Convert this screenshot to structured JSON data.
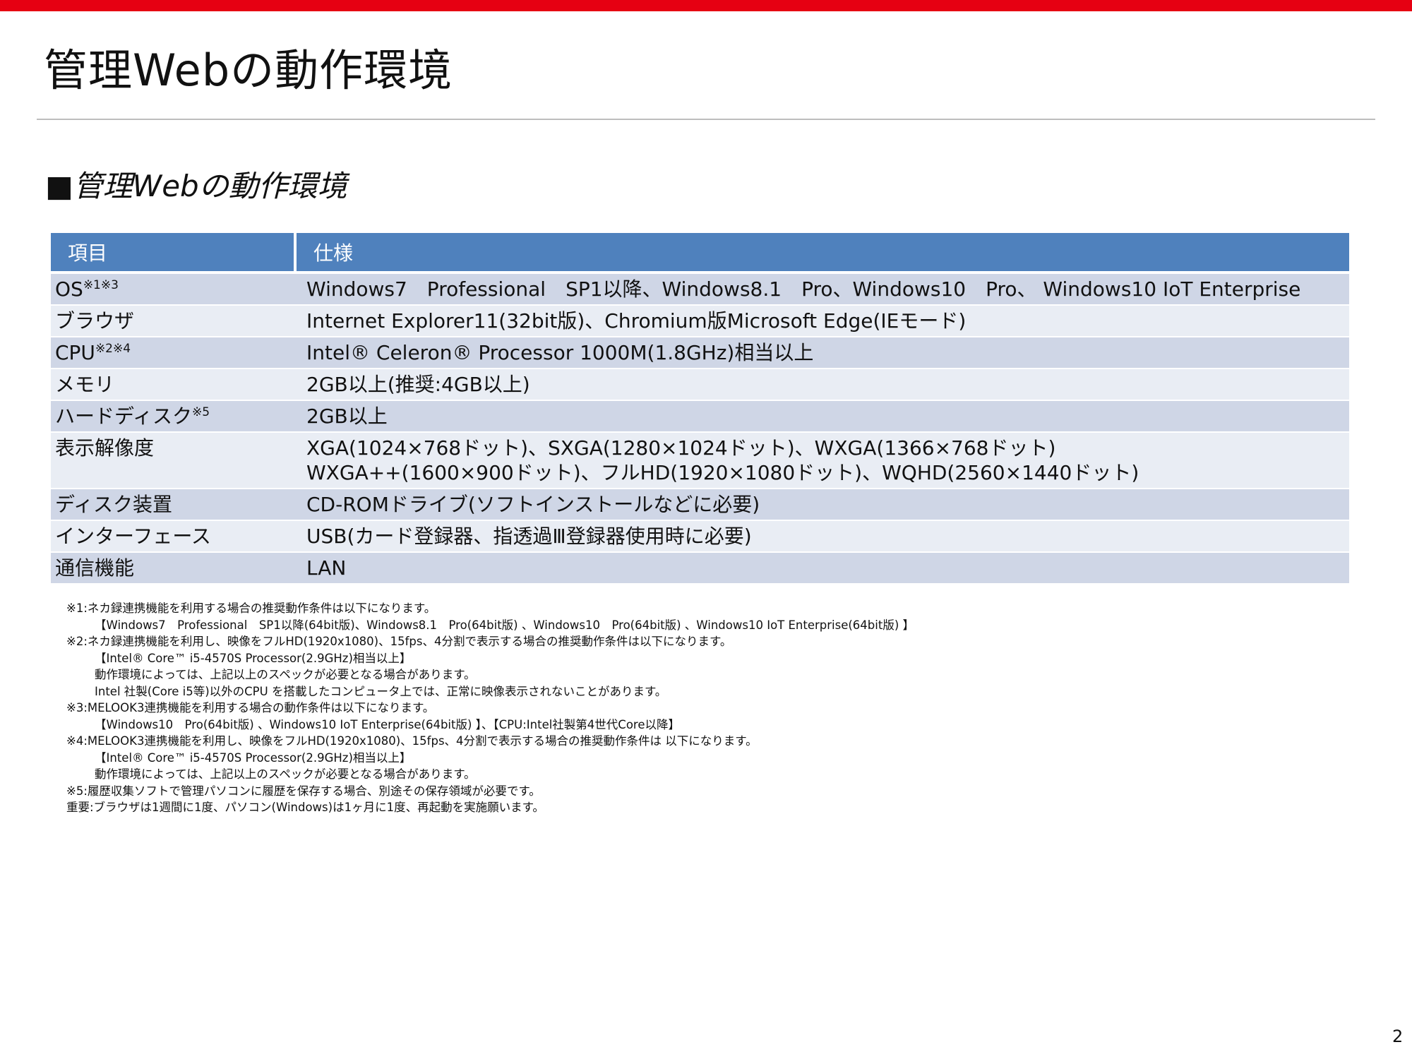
{
  "page": {
    "title": "管理Webの動作環境",
    "section_heading": "■管理Webの動作環境",
    "page_number": "2",
    "accent_color": "#e60012",
    "header_color": "#4f81bd"
  },
  "table": {
    "headers": [
      "項目",
      "仕様"
    ],
    "rows": [
      {
        "item": "OS",
        "sup": "※1※3",
        "spec": "Windows7　Professional　SP1以降、Windows8.1　Pro、Windows10　Pro、 Windows10 IoT Enterprise",
        "spec2": ""
      },
      {
        "item": "ブラウザ",
        "sup": "",
        "spec": "Internet Explorer11(32bit版)、Chromium版Microsoft Edge(IEモード)",
        "spec2": ""
      },
      {
        "item": "CPU",
        "sup": "※2※4",
        "spec": "Intel® Celeron® Processor 1000M(1.8GHz)相当以上",
        "spec2": ""
      },
      {
        "item": "メモリ",
        "sup": "",
        "spec": "2GB以上(推奨:4GB以上)",
        "spec2": ""
      },
      {
        "item": "ハードディスク",
        "sup": "※5",
        "spec": "2GB以上",
        "spec2": ""
      },
      {
        "item": "表示解像度",
        "sup": "",
        "spec": "XGA(1024×768ドット)、SXGA(1280×1024ドット)、WXGA(1366×768ドット)",
        "spec2": "WXGA++(1600×900ドット)、フルHD(1920×1080ドット)、WQHD(2560×1440ドット)"
      },
      {
        "item": "ディスク装置",
        "sup": "",
        "spec": "CD-ROMドライブ(ソフトインストールなどに必要)",
        "spec2": ""
      },
      {
        "item": "インターフェース",
        "sup": "",
        "spec": "USB(カード登録器、指透過Ⅲ登録器使用時に必要)",
        "spec2": ""
      },
      {
        "item": "通信機能",
        "sup": "",
        "spec": "LAN",
        "spec2": ""
      }
    ]
  },
  "notes": [
    {
      "text": "※1:ネカ録連携機能を利用する場合の推奨動作条件は以下になります。",
      "indent": false
    },
    {
      "text": "【Windows7　Professional　SP1以降(64bit版)、Windows8.1　Pro(64bit版) 、Windows10　Pro(64bit版) 、Windows10 IoT Enterprise(64bit版) 】",
      "indent": true
    },
    {
      "text": "※2:ネカ録連携機能を利用し、映像をフルHD(1920x1080)、15fps、4分割で表示する場合の推奨動作条件は以下になります。",
      "indent": false
    },
    {
      "text": "【Intel® Core™ i5-4570S Processor(2.9GHz)相当以上】",
      "indent": true
    },
    {
      "text": "動作環境によっては、上記以上のスペックが必要となる場合があります。",
      "indent": true
    },
    {
      "text": "Intel 社製(Core i5等)以外のCPU を搭載したコンピュータ上では、正常に映像表示されないことがあります。",
      "indent": true
    },
    {
      "text": "※3:MELOOK3連携機能を利用する場合の動作条件は以下になります。",
      "indent": false
    },
    {
      "text": "【Windows10　Pro(64bit版) 、Windows10 IoT Enterprise(64bit版) 】、【CPU:Intel社製第4世代Core以降】",
      "indent": true
    },
    {
      "text": "※4:MELOOK3連携機能を利用し、映像をフルHD(1920x1080)、15fps、4分割で表示する場合の推奨動作条件は 以下になります。",
      "indent": false
    },
    {
      "text": "【Intel® Core™ i5-4570S Processor(2.9GHz)相当以上】",
      "indent": true
    },
    {
      "text": "動作環境によっては、上記以上のスペックが必要となる場合があります。",
      "indent": true
    },
    {
      "text": "※5:履歴収集ソフトで管理パソコンに履歴を保存する場合、別途その保存領域が必要です。",
      "indent": false
    },
    {
      "text": "重要:ブラウザは1週間に1度、パソコン(Windows)は1ヶ月に1度、再起動を実施願います。",
      "indent": false
    }
  ]
}
